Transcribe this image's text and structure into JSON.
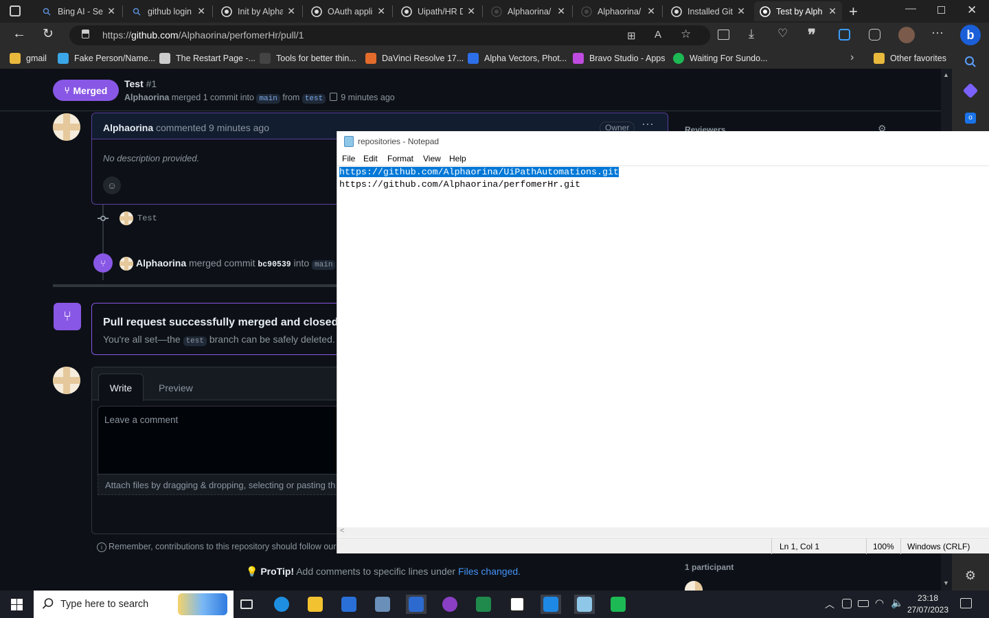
{
  "browser": {
    "tabs": [
      {
        "title": "Bing AI - Sea",
        "icon": "search-icon"
      },
      {
        "title": "github login",
        "icon": "search-icon"
      },
      {
        "title": "Init by Alpha",
        "icon": "github-icon"
      },
      {
        "title": "OAuth appli",
        "icon": "github-icon"
      },
      {
        "title": "Uipath/HR D",
        "icon": "github-icon"
      },
      {
        "title": "Alphaorina/",
        "icon": "github-icon"
      },
      {
        "title": "Alphaorina/",
        "icon": "github-icon"
      },
      {
        "title": "Installed Git",
        "icon": "github-icon"
      },
      {
        "title": "Test by Alph",
        "icon": "github-icon",
        "active": true
      }
    ],
    "url_prefix": "https://",
    "url_domain": "github.com",
    "url_path": "/Alphaorina/perfomerHr/pull/1",
    "favorites": [
      {
        "label": "gmail",
        "color": "#e8b93c"
      },
      {
        "label": "Fake Person/Name...",
        "color": "#3ba6e8"
      },
      {
        "label": "The Restart Page -...",
        "color": "#cccccc"
      },
      {
        "label": "Tools for better thin...",
        "color": "#444444"
      },
      {
        "label": "DaVinci Resolve 17...",
        "color": "#e36b2b"
      },
      {
        "label": "Alpha Vectors, Phot...",
        "color": "#2d6fe8"
      },
      {
        "label": "Bravo Studio - Apps",
        "color": "#c04be0"
      },
      {
        "label": "Waiting For Sundo...",
        "color": "#1db954"
      }
    ],
    "other_favorites": "Other favorites"
  },
  "pr": {
    "state": "Merged",
    "title": "Test",
    "number": "#1",
    "author": "Alphaorina",
    "merge_text": "merged 1 commit into",
    "base": "main",
    "from": "from",
    "head": "test",
    "time": "9 minutes ago"
  },
  "comment": {
    "author": "Alphaorina",
    "action": "commented 9 minutes ago",
    "badge": "Owner",
    "body": "No description provided."
  },
  "sidebar_right": {
    "reviewers": "Reviewers",
    "participants": "1 participant"
  },
  "timeline": {
    "commit_label": "Test",
    "merged_author": "Alphaorina",
    "merged_text": "merged commit",
    "commit_sha": "bc90539",
    "into": "into",
    "branch": "main"
  },
  "merged_box": {
    "title": "Pull request successfully merged and closed",
    "text_before": "You're all set—the",
    "branch": "test",
    "text_after": "branch can be safely deleted."
  },
  "editor": {
    "write_tab": "Write",
    "preview_tab": "Preview",
    "placeholder": "Leave a comment",
    "attach_text": "Attach files by dragging & dropping, selecting or pasting th",
    "contrib_note": "Remember, contributions to this repository should follow our"
  },
  "protip": {
    "label": "ProTip!",
    "text": "Add comments to specific lines under",
    "link": "Files changed."
  },
  "notepad": {
    "title": "repositories - Notepad",
    "menu": [
      "File",
      "Edit",
      "Format",
      "View",
      "Help"
    ],
    "line1": "https://github.com/Alphaorina/UiPathAutomations.git",
    "line2": "https://github.com/Alphaorina/perfomerHr.git",
    "status_pos": "Ln 1, Col 1",
    "status_zoom": "100%",
    "status_eol": "Windows (CRLF)"
  },
  "taskbar": {
    "search_placeholder": "Type here to search",
    "time": "23:18",
    "date": "27/07/2023"
  }
}
